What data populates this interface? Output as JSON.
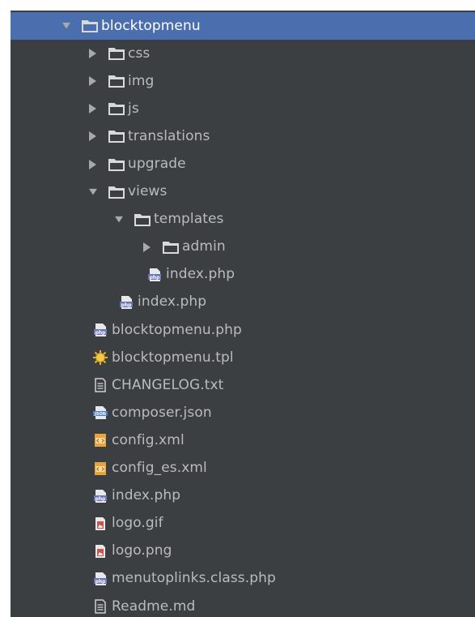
{
  "tree": {
    "items": [
      {
        "label": "blocktopmenu",
        "type": "folder",
        "depth": 0,
        "expanded": true,
        "selected": true,
        "icon": "folder-icon"
      },
      {
        "label": "css",
        "type": "folder",
        "depth": 1,
        "expanded": false,
        "icon": "folder-icon"
      },
      {
        "label": "img",
        "type": "folder",
        "depth": 1,
        "expanded": false,
        "icon": "folder-icon"
      },
      {
        "label": "js",
        "type": "folder",
        "depth": 1,
        "expanded": false,
        "icon": "folder-icon"
      },
      {
        "label": "translations",
        "type": "folder",
        "depth": 1,
        "expanded": false,
        "icon": "folder-icon"
      },
      {
        "label": "upgrade",
        "type": "folder",
        "depth": 1,
        "expanded": false,
        "icon": "folder-icon"
      },
      {
        "label": "views",
        "type": "folder",
        "depth": 1,
        "expanded": true,
        "icon": "folder-icon"
      },
      {
        "label": "templates",
        "type": "folder",
        "depth": 2,
        "expanded": true,
        "icon": "folder-icon"
      },
      {
        "label": "admin",
        "type": "folder",
        "depth": 3,
        "expanded": false,
        "icon": "folder-icon"
      },
      {
        "label": "index.php",
        "type": "php",
        "depth": 3,
        "icon": "php-file-icon"
      },
      {
        "label": "index.php",
        "type": "php",
        "depth": 2,
        "icon": "php-file-icon"
      },
      {
        "label": "blocktopmenu.php",
        "type": "php",
        "depth": 1,
        "icon": "php-file-icon"
      },
      {
        "label": "blocktopmenu.tpl",
        "type": "tpl",
        "depth": 1,
        "icon": "smarty-template-icon"
      },
      {
        "label": "CHANGELOG.txt",
        "type": "txt",
        "depth": 1,
        "icon": "text-file-icon"
      },
      {
        "label": "composer.json",
        "type": "json",
        "depth": 1,
        "icon": "json-file-icon"
      },
      {
        "label": "config.xml",
        "type": "xml",
        "depth": 1,
        "icon": "xml-file-icon"
      },
      {
        "label": "config_es.xml",
        "type": "xml",
        "depth": 1,
        "icon": "xml-file-icon"
      },
      {
        "label": "index.php",
        "type": "php",
        "depth": 1,
        "icon": "php-file-icon"
      },
      {
        "label": "logo.gif",
        "type": "image",
        "depth": 1,
        "icon": "image-file-icon"
      },
      {
        "label": "logo.png",
        "type": "image",
        "depth": 1,
        "icon": "image-file-icon"
      },
      {
        "label": "menutoplinks.class.php",
        "type": "php",
        "depth": 1,
        "icon": "php-file-icon"
      },
      {
        "label": "Readme.md",
        "type": "txt",
        "depth": 1,
        "icon": "text-file-icon"
      }
    ]
  },
  "colors": {
    "panel_bg": "#3c3f41",
    "selection_bg": "#4b6eaf",
    "text": "#bbbbbb",
    "selected_text": "#ffffff",
    "folder_fill": "#d9d9d9",
    "php_icon": "#6b76b6",
    "json_icon": "#4a7fc3",
    "xml_icon": "#e8a33b",
    "image_icon": "#c75450",
    "tpl_icon": "#e0b530"
  }
}
